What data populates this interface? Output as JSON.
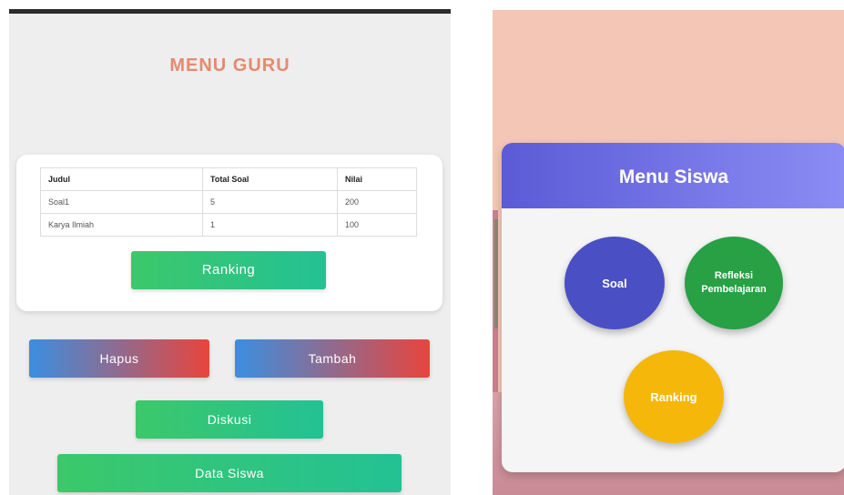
{
  "guru": {
    "title": "MENU GURU",
    "table": {
      "headers": [
        "Judul",
        "Total Soal",
        "Nilai"
      ],
      "rows": [
        [
          "Soal1",
          "5",
          "200"
        ],
        [
          "Karya Ilmiah",
          "1",
          "100"
        ]
      ]
    },
    "buttons": {
      "ranking": "Ranking",
      "hapus": "Hapus",
      "tambah": "Tambah",
      "diskusi": "Diskusi",
      "data_siswa": "Data Siswa"
    }
  },
  "siswa": {
    "title": "Menu Siswa",
    "menu": {
      "soal": "Soal",
      "refleksi": "Refleksi Pembelajaran",
      "ranking": "Ranking"
    }
  },
  "colors": {
    "guru_title": "#e58a6f",
    "green_button": "#3cc86a",
    "hapus_tambah_gradient": [
      "#3a8fe0",
      "#e8453c"
    ],
    "siswa_header": "#5b5bd6",
    "soal_circle": "#4b4fc4",
    "refleksi_circle": "#28a044",
    "ranking_circle": "#f5b70a",
    "siswa_background": "#f4c6b6"
  }
}
